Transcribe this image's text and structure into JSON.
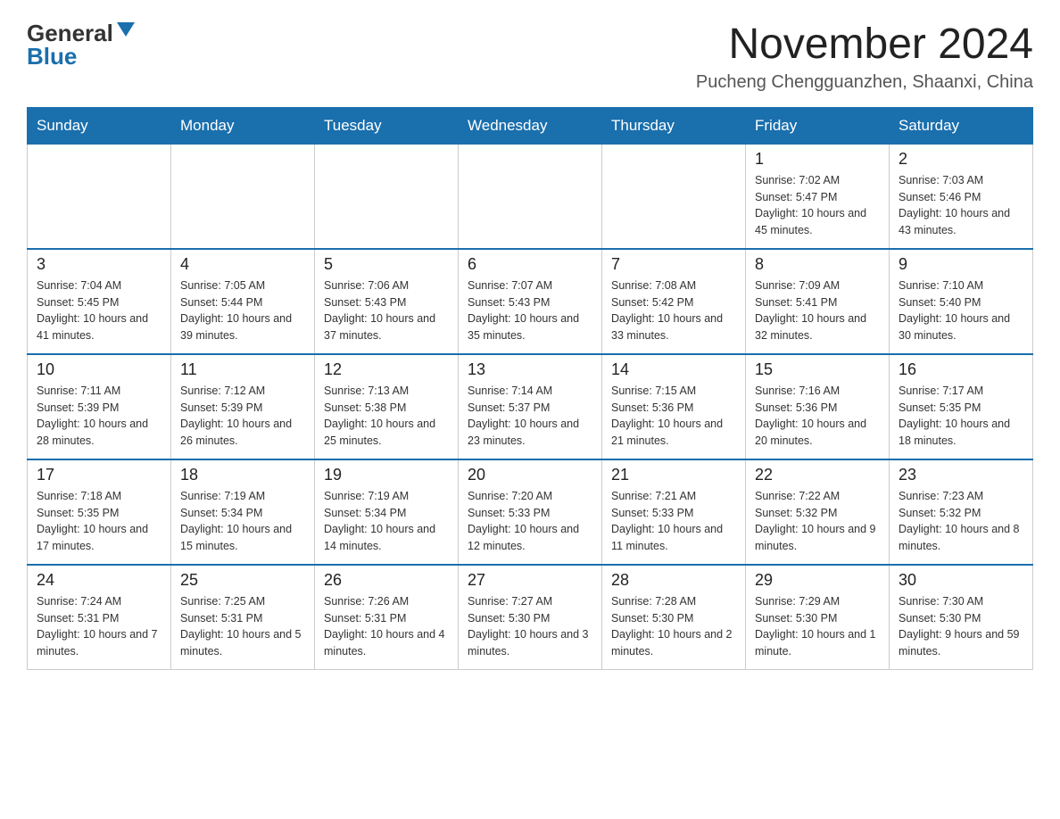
{
  "header": {
    "logo_general": "General",
    "logo_blue": "Blue",
    "month_title": "November 2024",
    "location": "Pucheng Chengguanzhen, Shaanxi, China"
  },
  "weekdays": [
    "Sunday",
    "Monday",
    "Tuesday",
    "Wednesday",
    "Thursday",
    "Friday",
    "Saturday"
  ],
  "weeks": [
    [
      {
        "day": "",
        "info": ""
      },
      {
        "day": "",
        "info": ""
      },
      {
        "day": "",
        "info": ""
      },
      {
        "day": "",
        "info": ""
      },
      {
        "day": "",
        "info": ""
      },
      {
        "day": "1",
        "info": "Sunrise: 7:02 AM\nSunset: 5:47 PM\nDaylight: 10 hours and 45 minutes."
      },
      {
        "day": "2",
        "info": "Sunrise: 7:03 AM\nSunset: 5:46 PM\nDaylight: 10 hours and 43 minutes."
      }
    ],
    [
      {
        "day": "3",
        "info": "Sunrise: 7:04 AM\nSunset: 5:45 PM\nDaylight: 10 hours and 41 minutes."
      },
      {
        "day": "4",
        "info": "Sunrise: 7:05 AM\nSunset: 5:44 PM\nDaylight: 10 hours and 39 minutes."
      },
      {
        "day": "5",
        "info": "Sunrise: 7:06 AM\nSunset: 5:43 PM\nDaylight: 10 hours and 37 minutes."
      },
      {
        "day": "6",
        "info": "Sunrise: 7:07 AM\nSunset: 5:43 PM\nDaylight: 10 hours and 35 minutes."
      },
      {
        "day": "7",
        "info": "Sunrise: 7:08 AM\nSunset: 5:42 PM\nDaylight: 10 hours and 33 minutes."
      },
      {
        "day": "8",
        "info": "Sunrise: 7:09 AM\nSunset: 5:41 PM\nDaylight: 10 hours and 32 minutes."
      },
      {
        "day": "9",
        "info": "Sunrise: 7:10 AM\nSunset: 5:40 PM\nDaylight: 10 hours and 30 minutes."
      }
    ],
    [
      {
        "day": "10",
        "info": "Sunrise: 7:11 AM\nSunset: 5:39 PM\nDaylight: 10 hours and 28 minutes."
      },
      {
        "day": "11",
        "info": "Sunrise: 7:12 AM\nSunset: 5:39 PM\nDaylight: 10 hours and 26 minutes."
      },
      {
        "day": "12",
        "info": "Sunrise: 7:13 AM\nSunset: 5:38 PM\nDaylight: 10 hours and 25 minutes."
      },
      {
        "day": "13",
        "info": "Sunrise: 7:14 AM\nSunset: 5:37 PM\nDaylight: 10 hours and 23 minutes."
      },
      {
        "day": "14",
        "info": "Sunrise: 7:15 AM\nSunset: 5:36 PM\nDaylight: 10 hours and 21 minutes."
      },
      {
        "day": "15",
        "info": "Sunrise: 7:16 AM\nSunset: 5:36 PM\nDaylight: 10 hours and 20 minutes."
      },
      {
        "day": "16",
        "info": "Sunrise: 7:17 AM\nSunset: 5:35 PM\nDaylight: 10 hours and 18 minutes."
      }
    ],
    [
      {
        "day": "17",
        "info": "Sunrise: 7:18 AM\nSunset: 5:35 PM\nDaylight: 10 hours and 17 minutes."
      },
      {
        "day": "18",
        "info": "Sunrise: 7:19 AM\nSunset: 5:34 PM\nDaylight: 10 hours and 15 minutes."
      },
      {
        "day": "19",
        "info": "Sunrise: 7:19 AM\nSunset: 5:34 PM\nDaylight: 10 hours and 14 minutes."
      },
      {
        "day": "20",
        "info": "Sunrise: 7:20 AM\nSunset: 5:33 PM\nDaylight: 10 hours and 12 minutes."
      },
      {
        "day": "21",
        "info": "Sunrise: 7:21 AM\nSunset: 5:33 PM\nDaylight: 10 hours and 11 minutes."
      },
      {
        "day": "22",
        "info": "Sunrise: 7:22 AM\nSunset: 5:32 PM\nDaylight: 10 hours and 9 minutes."
      },
      {
        "day": "23",
        "info": "Sunrise: 7:23 AM\nSunset: 5:32 PM\nDaylight: 10 hours and 8 minutes."
      }
    ],
    [
      {
        "day": "24",
        "info": "Sunrise: 7:24 AM\nSunset: 5:31 PM\nDaylight: 10 hours and 7 minutes."
      },
      {
        "day": "25",
        "info": "Sunrise: 7:25 AM\nSunset: 5:31 PM\nDaylight: 10 hours and 5 minutes."
      },
      {
        "day": "26",
        "info": "Sunrise: 7:26 AM\nSunset: 5:31 PM\nDaylight: 10 hours and 4 minutes."
      },
      {
        "day": "27",
        "info": "Sunrise: 7:27 AM\nSunset: 5:30 PM\nDaylight: 10 hours and 3 minutes."
      },
      {
        "day": "28",
        "info": "Sunrise: 7:28 AM\nSunset: 5:30 PM\nDaylight: 10 hours and 2 minutes."
      },
      {
        "day": "29",
        "info": "Sunrise: 7:29 AM\nSunset: 5:30 PM\nDaylight: 10 hours and 1 minute."
      },
      {
        "day": "30",
        "info": "Sunrise: 7:30 AM\nSunset: 5:30 PM\nDaylight: 9 hours and 59 minutes."
      }
    ]
  ]
}
